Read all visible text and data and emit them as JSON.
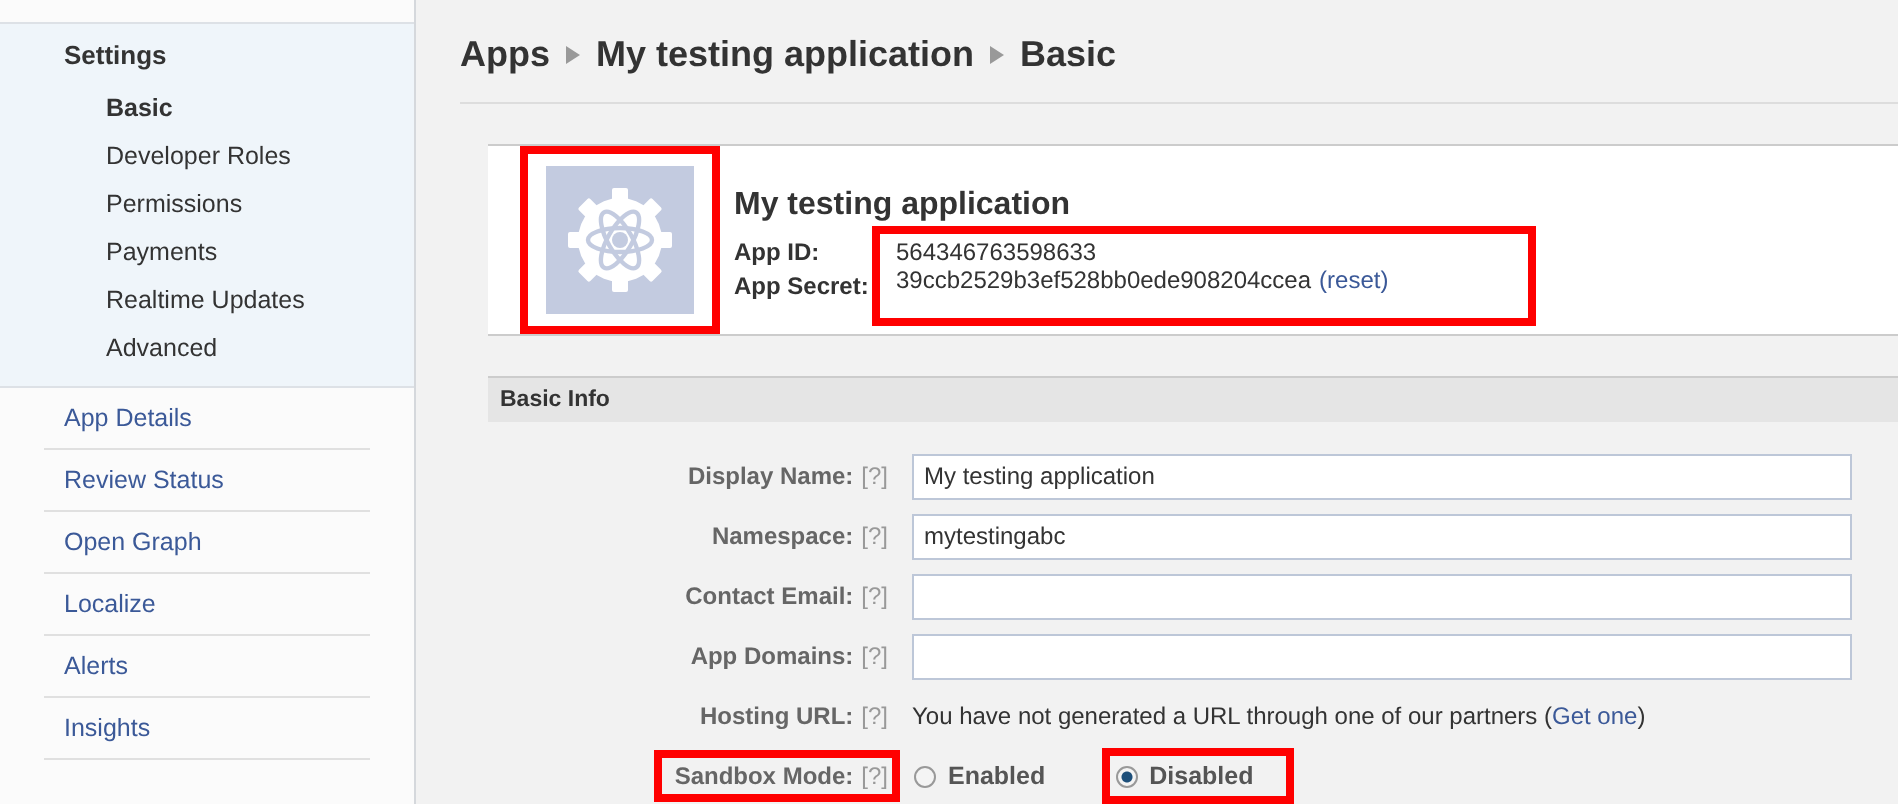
{
  "sidebar": {
    "section": {
      "label": "Settings",
      "children": [
        {
          "label": "Basic",
          "selected": true
        },
        {
          "label": "Developer Roles",
          "selected": false
        },
        {
          "label": "Permissions",
          "selected": false
        },
        {
          "label": "Payments",
          "selected": false
        },
        {
          "label": "Realtime Updates",
          "selected": false
        },
        {
          "label": "Advanced",
          "selected": false
        }
      ]
    },
    "items": [
      {
        "label": "App Details"
      },
      {
        "label": "Review Status"
      },
      {
        "label": "Open Graph"
      },
      {
        "label": "Localize"
      },
      {
        "label": "Alerts"
      },
      {
        "label": "Insights"
      }
    ]
  },
  "breadcrumb": [
    "Apps",
    "My testing application",
    "Basic"
  ],
  "app": {
    "name": "My testing application",
    "logo_highlighted": true,
    "credentials_highlighted": true,
    "fields": [
      {
        "label": "App ID:",
        "value": "564346763598633"
      },
      {
        "label": "App Secret:",
        "value": "39ccb2529b3ef528bb0ede908204ccea",
        "action": "(reset)"
      }
    ]
  },
  "basic_info": {
    "title": "Basic Info",
    "rows": [
      {
        "kind": "input",
        "label": "Display Name:",
        "help": "[?]",
        "value": "My testing application",
        "highlighted": false
      },
      {
        "kind": "input",
        "label": "Namespace:",
        "help": "[?]",
        "value": "mytestingabc",
        "highlighted": false
      },
      {
        "kind": "input",
        "label": "Contact Email:",
        "help": "[?]",
        "highlighted": false
      },
      {
        "kind": "input",
        "label": "App Domains:",
        "help": "[?]",
        "highlighted": false
      },
      {
        "kind": "text",
        "label": "Hosting URL:",
        "help": "[?]",
        "text": "You have not generated a URL through one of our partners (",
        "link": "Get one",
        "text_after": ")",
        "highlighted": false
      },
      {
        "kind": "radio",
        "label": "Sandbox Mode:",
        "help": "[?]",
        "highlighted": true,
        "options": [
          {
            "label": "Enabled",
            "selected": false,
            "highlighted": false
          },
          {
            "label": "Disabled",
            "selected": true,
            "highlighted": true
          }
        ]
      }
    ]
  }
}
